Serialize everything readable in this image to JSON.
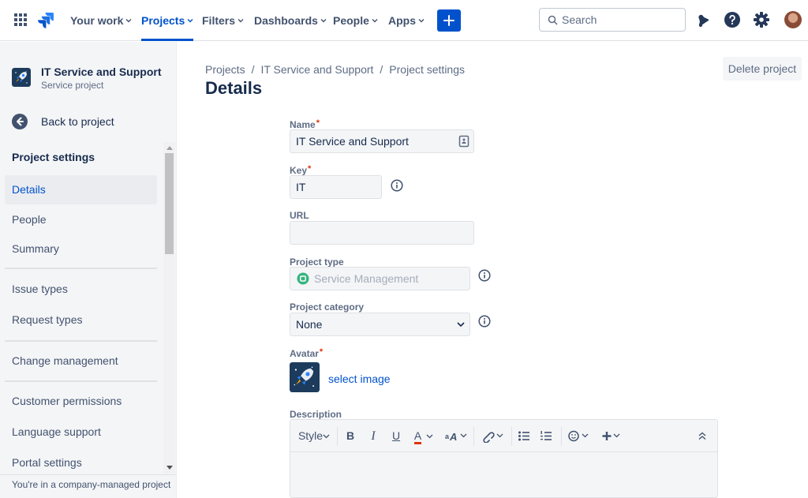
{
  "topnav": {
    "items": [
      {
        "label": "Your work"
      },
      {
        "label": "Projects"
      },
      {
        "label": "Filters"
      },
      {
        "label": "Dashboards"
      },
      {
        "label": "People"
      },
      {
        "label": "Apps"
      }
    ],
    "active": "Projects",
    "search_placeholder": "Search",
    "icons": [
      "app-switcher-icon",
      "jira-logo-icon",
      "plus-icon",
      "search-icon",
      "notifications-icon",
      "help-icon",
      "settings-icon"
    ]
  },
  "sidebar": {
    "project_name": "IT Service and Support",
    "project_type": "Service project",
    "back_label": "Back to project",
    "heading": "Project settings",
    "items": [
      {
        "label": "Details"
      },
      {
        "label": "People"
      },
      {
        "label": "Summary"
      },
      {
        "label": "Issue types"
      },
      {
        "label": "Request types"
      },
      {
        "label": "Change management"
      },
      {
        "label": "Customer permissions"
      },
      {
        "label": "Language support"
      },
      {
        "label": "Portal settings"
      }
    ],
    "selected": "Details",
    "footer": "You're in a company-managed project"
  },
  "main": {
    "breadcrumb": [
      "Projects",
      "IT Service and Support",
      "Project settings"
    ],
    "breadcrumb_sep": "/",
    "title": "Details",
    "delete_label": "Delete project",
    "form": {
      "name_label": "Name",
      "name_value": "IT Service and Support",
      "key_label": "Key",
      "key_value": "IT",
      "url_label": "URL",
      "url_value": "",
      "type_label": "Project type",
      "type_value": "Service Management",
      "category_label": "Project category",
      "category_value": "None",
      "avatar_label": "Avatar",
      "select_image": "select image",
      "description_label": "Description",
      "required_mark": "*"
    },
    "editor_toolbar": {
      "style_label": "Style",
      "bold": "B",
      "italic": "I",
      "underline": "U",
      "text_color": "A"
    }
  },
  "colors": {
    "accent": "#0052cc",
    "required": "#de350b",
    "text": "#172b4d",
    "subtle": "#5e6c84",
    "sidebar_bg": "#f4f5f7",
    "service_green": "#36b37e"
  }
}
